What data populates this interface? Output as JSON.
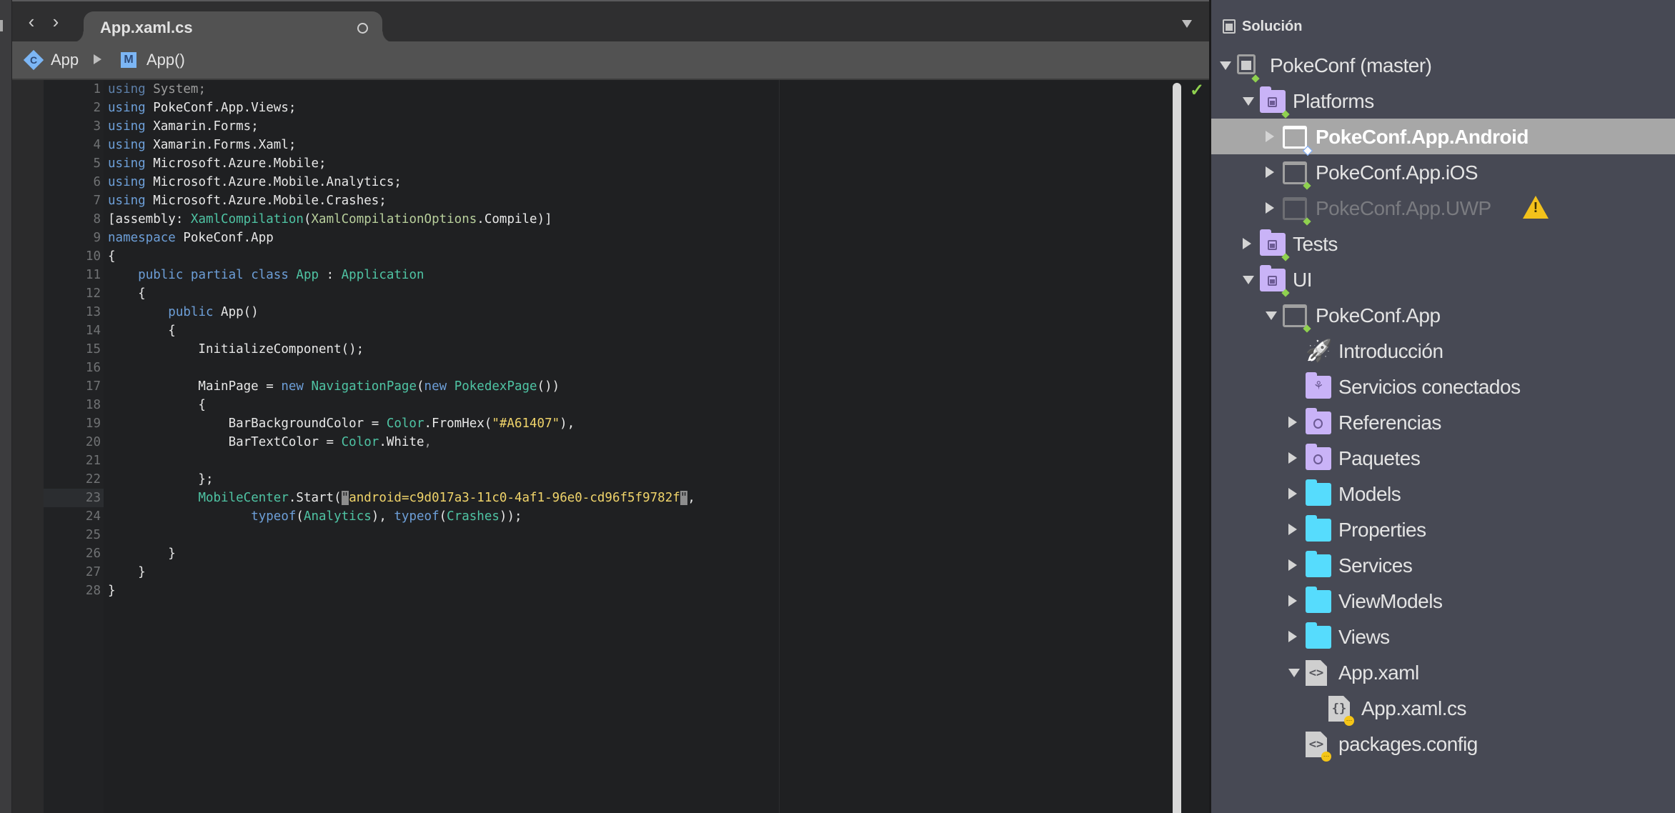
{
  "editor": {
    "tab": {
      "label": "App.xaml.cs"
    },
    "breadcrumb": [
      {
        "icon": "class-icon",
        "glyph": "C",
        "label": "App"
      },
      {
        "icon": "method-icon",
        "glyph": "M",
        "label": "App()"
      }
    ],
    "status_icon": "✓",
    "nav": {
      "back": "‹",
      "forward": "›"
    },
    "current_line": 23,
    "lines": [
      {
        "n": "1",
        "tokens": [
          [
            "kw-dim",
            "using"
          ],
          [
            "dim",
            " System;"
          ]
        ]
      },
      {
        "n": "2",
        "tokens": [
          [
            "kw",
            "using"
          ],
          [
            "",
            ""
          ],
          [
            "",
            " PokeConf.App.Views;"
          ]
        ]
      },
      {
        "n": "3",
        "tokens": [
          [
            "kw",
            "using"
          ],
          [
            "",
            " Xamarin.Forms;"
          ]
        ]
      },
      {
        "n": "4",
        "tokens": [
          [
            "kw",
            "using"
          ],
          [
            "",
            " Xamarin.Forms.Xaml;"
          ]
        ]
      },
      {
        "n": "5",
        "tokens": [
          [
            "kw",
            "using"
          ],
          [
            "",
            " Microsoft.Azure.Mobile;"
          ]
        ]
      },
      {
        "n": "6",
        "tokens": [
          [
            "kw",
            "using"
          ],
          [
            "",
            " Microsoft.Azure.Mobile.Analytics;"
          ]
        ]
      },
      {
        "n": "7",
        "tokens": [
          [
            "kw",
            "using"
          ],
          [
            "",
            " Microsoft.Azure.Mobile.Crashes;"
          ]
        ]
      },
      {
        "n": "8",
        "tokens": [
          [
            "",
            "[assembly: "
          ],
          [
            "ty",
            "XamlCompilation"
          ],
          [
            "",
            "("
          ],
          [
            "ty2",
            "XamlCompilationOptions"
          ],
          [
            "",
            ".Compile)]"
          ]
        ]
      },
      {
        "n": "9",
        "tokens": [
          [
            "kw",
            "namespace"
          ],
          [
            "",
            " PokeConf.App"
          ]
        ]
      },
      {
        "n": "10",
        "tokens": [
          [
            "",
            "{"
          ]
        ]
      },
      {
        "n": "11",
        "tokens": [
          [
            "",
            "    "
          ],
          [
            "kw",
            "public partial class"
          ],
          [
            "",
            " "
          ],
          [
            "ty",
            "App"
          ],
          [
            "",
            " : "
          ],
          [
            "ty",
            "Application"
          ]
        ]
      },
      {
        "n": "12",
        "tokens": [
          [
            "",
            "    {"
          ]
        ]
      },
      {
        "n": "13",
        "tokens": [
          [
            "",
            "        "
          ],
          [
            "kw",
            "public"
          ],
          [
            "",
            " App()"
          ]
        ]
      },
      {
        "n": "14",
        "tokens": [
          [
            "",
            "        {"
          ]
        ]
      },
      {
        "n": "15",
        "tokens": [
          [
            "",
            "            InitializeComponent();"
          ]
        ]
      },
      {
        "n": "16",
        "tokens": []
      },
      {
        "n": "17",
        "tokens": [
          [
            "",
            "            MainPage = "
          ],
          [
            "kw",
            "new"
          ],
          [
            "",
            " "
          ],
          [
            "ty",
            "NavigationPage"
          ],
          [
            "",
            "("
          ],
          [
            "kw",
            "new"
          ],
          [
            "",
            " "
          ],
          [
            "ty",
            "PokedexPage"
          ],
          [
            "",
            "())"
          ]
        ]
      },
      {
        "n": "18",
        "tokens": [
          [
            "",
            "            {"
          ]
        ]
      },
      {
        "n": "19",
        "tokens": [
          [
            "",
            "                BarBackgroundColor = "
          ],
          [
            "ty",
            "Color"
          ],
          [
            "",
            ".FromHex("
          ],
          [
            "str",
            "\"#A61407\""
          ],
          [
            "",
            "),"
          ]
        ]
      },
      {
        "n": "20",
        "tokens": [
          [
            "",
            "                BarTextColor = "
          ],
          [
            "ty",
            "Color"
          ],
          [
            "",
            ".White"
          ],
          [
            "dim",
            ","
          ]
        ]
      },
      {
        "n": "21",
        "tokens": []
      },
      {
        "n": "22",
        "tokens": [
          [
            "",
            "            };"
          ]
        ]
      },
      {
        "n": "23",
        "tokens": [
          [
            "",
            "            "
          ],
          [
            "ty",
            "MobileCenter"
          ],
          [
            "",
            ".Start("
          ],
          [
            "cur",
            "\""
          ],
          [
            "str",
            "android=c9d017a3-11c0-4af1-96e0-cd96f5f9782f"
          ],
          [
            "cur",
            "\""
          ],
          [
            "",
            ","
          ]
        ]
      },
      {
        "n": "24",
        "tokens": [
          [
            "",
            "                   "
          ],
          [
            "kw",
            "typeof"
          ],
          [
            "",
            "("
          ],
          [
            "ty",
            "Analytics"
          ],
          [
            "",
            "), "
          ],
          [
            "kw",
            "typeof"
          ],
          [
            "",
            "("
          ],
          [
            "ty",
            "Crashes"
          ],
          [
            "",
            "));"
          ]
        ]
      },
      {
        "n": "25",
        "tokens": []
      },
      {
        "n": "26",
        "tokens": [
          [
            "",
            "        }"
          ]
        ]
      },
      {
        "n": "27",
        "tokens": [
          [
            "",
            "    }"
          ]
        ]
      },
      {
        "n": "28",
        "tokens": [
          [
            "",
            "}"
          ]
        ]
      }
    ]
  },
  "solution_pad": {
    "title": "Solución",
    "items": [
      {
        "label": "PokeConf (master)",
        "depth": 0,
        "arrow": "open",
        "icon": "solution-icon",
        "badge": "green"
      },
      {
        "label": "Platforms",
        "depth": 1,
        "arrow": "open",
        "icon": "solution-folder-icon",
        "badge": "green"
      },
      {
        "label": "PokeConf.App.Android",
        "depth": 2,
        "arrow": "closed",
        "icon": "project-icon",
        "badge": "blue",
        "selected": true
      },
      {
        "label": "PokeConf.App.iOS",
        "depth": 2,
        "arrow": "closed",
        "icon": "project-icon",
        "badge": "green"
      },
      {
        "label": "PokeConf.App.UWP",
        "depth": 2,
        "arrow": "closed",
        "icon": "project-icon",
        "badge": "green",
        "disabled": true,
        "warning": "!"
      },
      {
        "label": "Tests",
        "depth": 1,
        "arrow": "closed",
        "icon": "solution-folder-icon",
        "badge": "green"
      },
      {
        "label": "UI",
        "depth": 1,
        "arrow": "open",
        "icon": "solution-folder-icon",
        "badge": "green"
      },
      {
        "label": "PokeConf.App",
        "depth": 2,
        "arrow": "open",
        "icon": "project-icon",
        "badge": "green"
      },
      {
        "label": "Introducción",
        "depth": 3,
        "arrow": "none",
        "icon": "rocket-icon"
      },
      {
        "label": "Servicios conectados",
        "depth": 3,
        "arrow": "none",
        "icon": "connected-services-folder-icon"
      },
      {
        "label": "Referencias",
        "depth": 3,
        "arrow": "closed",
        "icon": "references-folder-icon"
      },
      {
        "label": "Paquetes",
        "depth": 3,
        "arrow": "closed",
        "icon": "packages-folder-icon"
      },
      {
        "label": "Models",
        "depth": 3,
        "arrow": "closed",
        "icon": "folder-icon"
      },
      {
        "label": "Properties",
        "depth": 3,
        "arrow": "closed",
        "icon": "folder-icon"
      },
      {
        "label": "Services",
        "depth": 3,
        "arrow": "closed",
        "icon": "folder-icon"
      },
      {
        "label": "ViewModels",
        "depth": 3,
        "arrow": "closed",
        "icon": "folder-icon"
      },
      {
        "label": "Views",
        "depth": 3,
        "arrow": "closed",
        "icon": "folder-icon"
      },
      {
        "label": "App.xaml",
        "depth": 3,
        "arrow": "open",
        "icon": "xml-file-icon",
        "glyph": "<>"
      },
      {
        "label": "App.xaml.cs",
        "depth": 4,
        "arrow": "none",
        "icon": "csharp-file-icon",
        "glyph": "{}",
        "badge": "yellow"
      },
      {
        "label": "packages.config",
        "depth": 3,
        "arrow": "none",
        "icon": "xml-file-icon",
        "glyph": "<>",
        "badge": "yellow"
      }
    ]
  },
  "colors": {
    "keyword": "#6d9fd8",
    "type": "#4fc4a4",
    "string": "#f0d46a",
    "folder_purple": "#c9b3f7",
    "folder_cyan": "#56dcfd",
    "warning": "#f3c21b",
    "ok_check": "#8fd14f"
  }
}
